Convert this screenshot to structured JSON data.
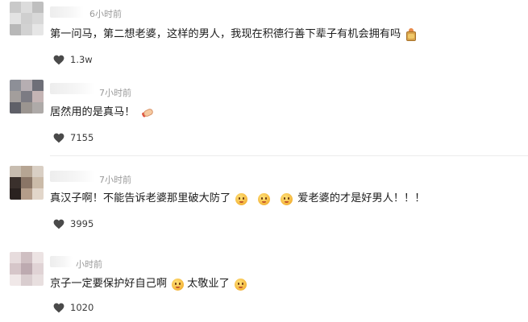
{
  "comments": [
    {
      "time": "6小时前",
      "text_parts": [
        "第一问马，第二想老婆，这样的男人，我现在积德行善下辈子有机会拥有吗"
      ],
      "emoji_end": "gift",
      "likes": "1.3w",
      "avatar_colors": [
        "#c9c9c9",
        "#dcdcdc",
        "#bfbfbf",
        "#e3e3e3",
        "#cfcfcf",
        "#d8d8d8",
        "#b8b8b8",
        "#d2d2d2",
        "#e6e6e6"
      ]
    },
    {
      "time": "7小时前",
      "text_parts": [
        "居然用的是真马！"
      ],
      "emoji_end": "hand",
      "likes": "7155",
      "avatar_colors": [
        "#8d8f97",
        "#b6aeb2",
        "#6e6f78",
        "#a39e9c",
        "#7c7b83",
        "#c4b4b4",
        "#5f6068",
        "#9b9590",
        "#aeaaa8"
      ]
    },
    {
      "time": "7小时前",
      "text_parts": [
        "真汉子啊！不能告诉老婆那里破大防了",
        "",
        "",
        "爱老婆的才是好男人！！！"
      ],
      "likes": "3995",
      "avatar_colors": [
        "#c8bdb0",
        "#b6a593",
        "#d9cfc4",
        "#3a302c",
        "#8a7566",
        "#cbbba9",
        "#2a2220",
        "#b49d8a",
        "#e2d6ca"
      ]
    },
    {
      "time": "小时前",
      "text_parts": [
        "京子一定要保护好自己啊",
        "太敬业了",
        ""
      ],
      "likes": "1020",
      "avatar_colors": [
        "#e7dcdd",
        "#cfbfc2",
        "#ece3e3",
        "#d6c6c9",
        "#bdaab0",
        "#e0d3d5",
        "#f0e8e8",
        "#d9cdcf",
        "#e8dfdf"
      ]
    }
  ],
  "icons": {
    "like": "heart-icon",
    "emoji_face": "smiley-emoji-icon"
  },
  "colors": {
    "text": "#1c1c1c",
    "time": "#9a9a9a",
    "heart": "#4a4a4a",
    "divider": "#ececec"
  }
}
